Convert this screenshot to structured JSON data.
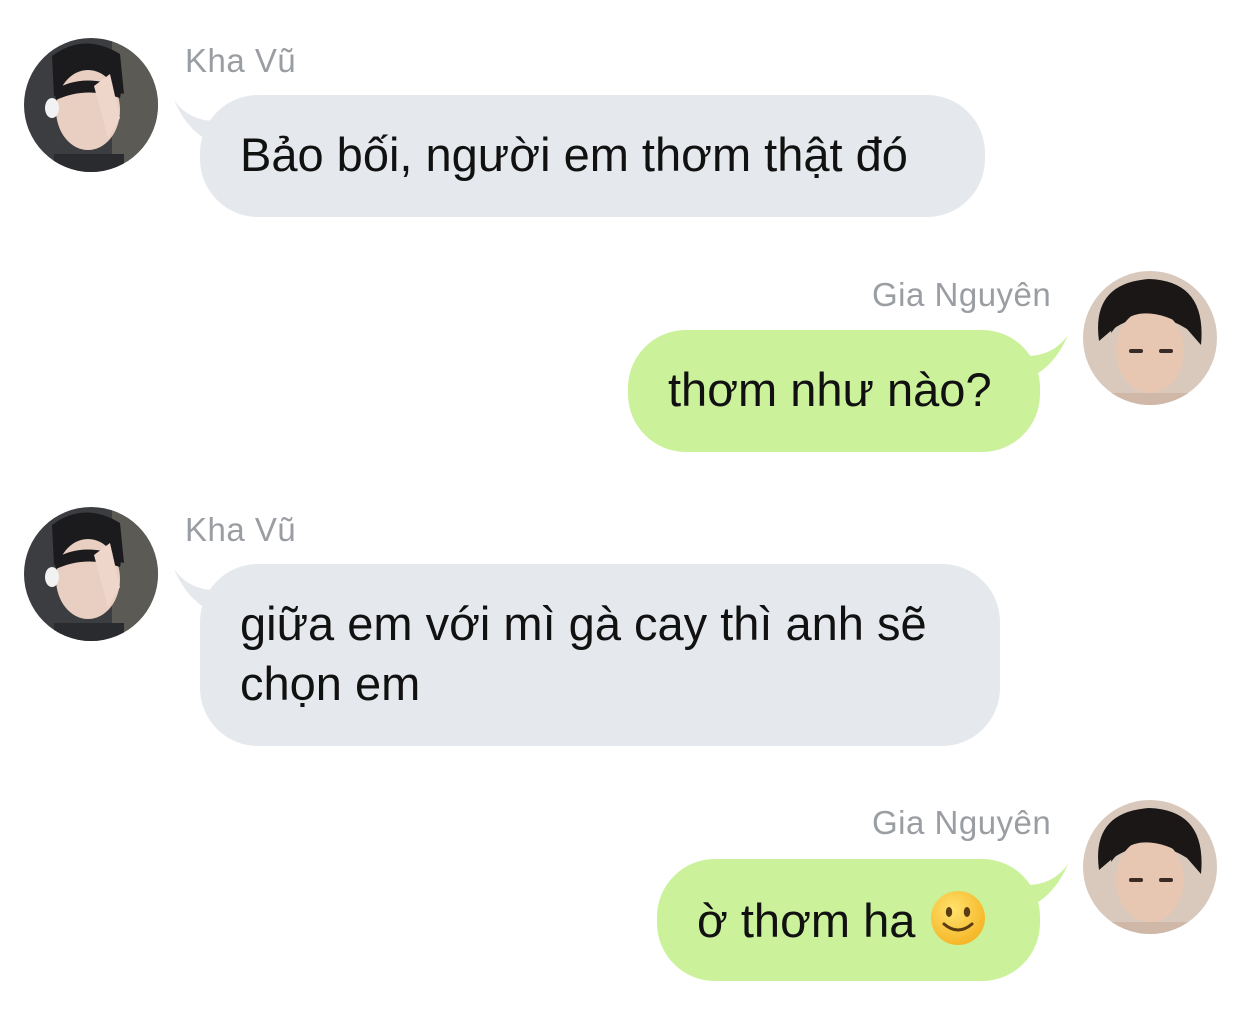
{
  "colors": {
    "incoming_bubble": "#e5e8ec",
    "outgoing_bubble": "#cbf19a",
    "sender_name": "#9a9ea3",
    "text": "#111111"
  },
  "messages": [
    {
      "sender": "Kha Vũ",
      "direction": "incoming",
      "avatar": "kha-vu-avatar",
      "text": "Bảo bối, người em thơm thật đó"
    },
    {
      "sender": "Gia Nguyên",
      "direction": "outgoing",
      "avatar": "gia-nguyen-avatar",
      "text": "thơm như nào?"
    },
    {
      "sender": "Kha Vũ",
      "direction": "incoming",
      "avatar": "kha-vu-avatar",
      "text_line1": "giữa em với mì gà cay thì anh sẽ",
      "text_line2": "chọn em"
    },
    {
      "sender": "Gia Nguyên",
      "direction": "outgoing",
      "avatar": "gia-nguyen-avatar",
      "text": "ờ thơm ha",
      "emoji": "slightly-smiling-face-emoji"
    }
  ]
}
